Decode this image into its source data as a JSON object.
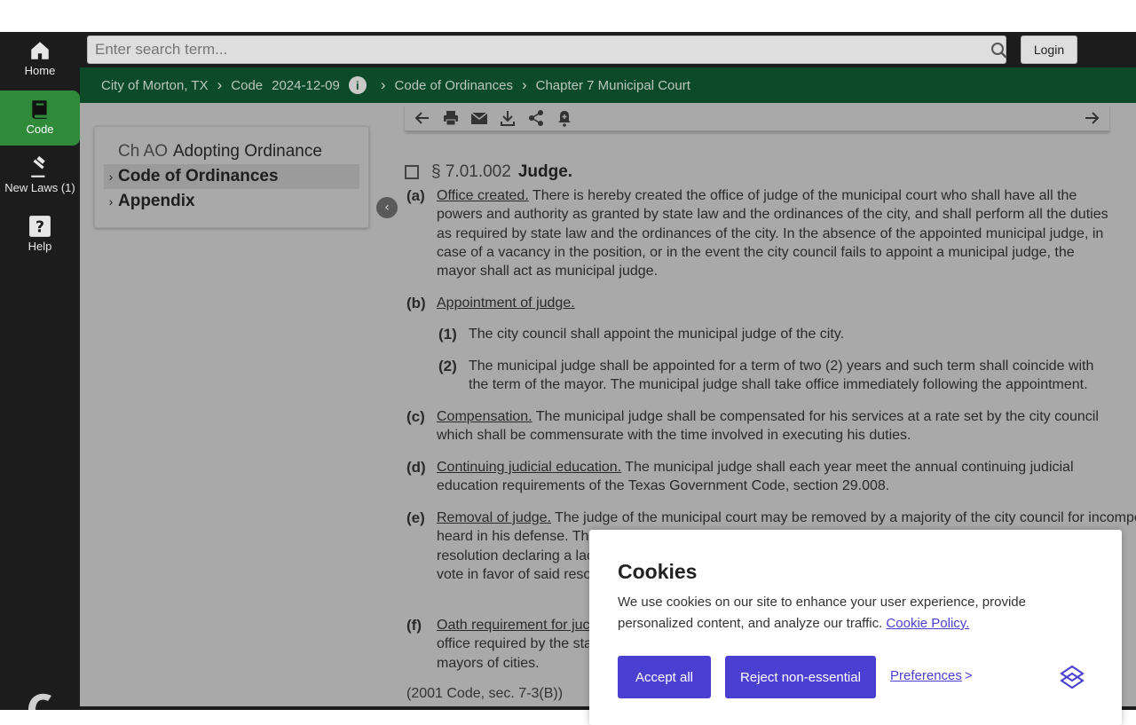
{
  "rail": {
    "items": [
      {
        "label": "Home",
        "icon": "home-icon"
      },
      {
        "label": "Code",
        "icon": "book-icon",
        "active": true
      },
      {
        "label": "New Laws (1)",
        "icon": "gavel-icon"
      },
      {
        "label": "Help",
        "icon": "help-icon"
      }
    ]
  },
  "search": {
    "placeholder": "Enter search term...",
    "login_label": "Login"
  },
  "breadcrumb": {
    "items": [
      "City of Morton, TX",
      "Code",
      "2024-12-09",
      "Code of Ordinances",
      "Chapter 7 Municipal Court"
    ]
  },
  "toc": {
    "items": [
      {
        "prefix": "Ch AO",
        "label": "Adopting Ordinance"
      },
      {
        "label": "Code of Ordinances"
      },
      {
        "label": "Appendix"
      }
    ]
  },
  "section": {
    "number": "§ 7.01.002",
    "title": "Judge.",
    "paragraphs": [
      {
        "letter": "(a)",
        "heading": "Office created.",
        "text": " There is hereby created the office of judge of the municipal court who shall have all the powers and authority as granted by state law and the ordinances of the city, and shall perform all the duties as required by state law and the ordinances of the city. In the absence of the appointed municipal judge, in case of a vacancy in the position, or in the event the city council fails to appoint a municipal judge, the mayor shall act as municipal judge."
      },
      {
        "letter": "(b)",
        "heading": "Appointment of judge.",
        "text": ""
      },
      {
        "letter": "(c)",
        "heading": "Compensation.",
        "text": " The municipal judge shall be compensated for his services at a rate set by the city council which shall be commensurate with the time involved in executing his duties."
      },
      {
        "letter": "(d)",
        "heading": "Continuing judicial education.",
        "text": " The municipal judge shall each year meet the annual continuing judicial education requirements of the Texas Government Code, section 29.008."
      },
      {
        "letter": "(e)",
        "heading": "Removal of judge.",
        "text": " The judge of the municipal court may be removed by a majority of the city council for incompetency, corruptic",
        "text_line2": "heard in his defense. The",
        "text_line3": "resolution declaring a lac",
        "text_line4": "vote in favor of said reso"
      },
      {
        "letter": "(f)",
        "heading": "Oath requirement for juc",
        "text_line2": "office required by the sta",
        "text_line3": "mayors of cities."
      }
    ],
    "subitems": [
      {
        "letter": "(1)",
        "text": "The city council shall appoint the municipal judge of the city."
      },
      {
        "letter": "(2)",
        "text": "The municipal judge shall be appointed for a term of two (2) years and such term shall coincide with the term of the mayor. The municipal judge shall take office immediately following the appointment."
      }
    ],
    "history": "(2001 Code, sec. 7-3(B))"
  },
  "cookie": {
    "title": "Cookies",
    "message": "We use cookies on our site to enhance your user experience, provide personalized content, and analyze our traffic. ",
    "policy_link": "Cookie Policy.",
    "accept_label": "Accept all",
    "reject_label": "Reject non-essential",
    "preferences_label": "Preferences",
    "preferences_arrow": ">"
  },
  "colors": {
    "rail_active": "#2f8a3a",
    "breadcrumb_bg": "#0d4a2a",
    "cookie_accent": "#4b3fd1"
  }
}
